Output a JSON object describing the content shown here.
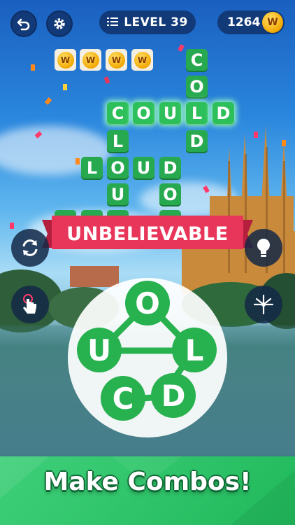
{
  "header": {
    "back_icon": "undo-icon",
    "settings_icon": "gear-icon",
    "level_label": "LEVEL 39",
    "coins": "1264",
    "coin_symbol": "W"
  },
  "bonus_coins": [
    "W",
    "W",
    "W",
    "W"
  ],
  "board": {
    "tiles": [
      {
        "letter": "C",
        "row": 0,
        "col": "word-could-v"
      },
      {
        "letter": "O"
      },
      {
        "letter": "L"
      }
    ]
  },
  "words": {
    "could_horizontal": [
      "C",
      "O",
      "U",
      "L",
      "D"
    ],
    "cold_vertical": [
      "C",
      "O",
      "L",
      "D"
    ],
    "loud_horizontal": [
      "L",
      "O",
      "U",
      "D"
    ],
    "cloud_vertical_visible": [
      "L",
      "U"
    ],
    "dos_vertical_visible": [
      "O"
    ]
  },
  "banner": "UNBELIEVABLE",
  "wheel_letters": {
    "top": "O",
    "left": "U",
    "right": "L",
    "bottom_left": "C",
    "bottom_right": "D"
  },
  "side_buttons": {
    "shuffle": "shuffle-icon",
    "hint": "lightbulb-icon",
    "finger": "finger-tap-icon",
    "firework": "firework-icon"
  },
  "footer_text": "Make Combos!",
  "colors": {
    "tile_green": "#27a94f",
    "banner_red": "#e8365a",
    "navy": "#123a78",
    "coin_gold": "#f2a800"
  }
}
